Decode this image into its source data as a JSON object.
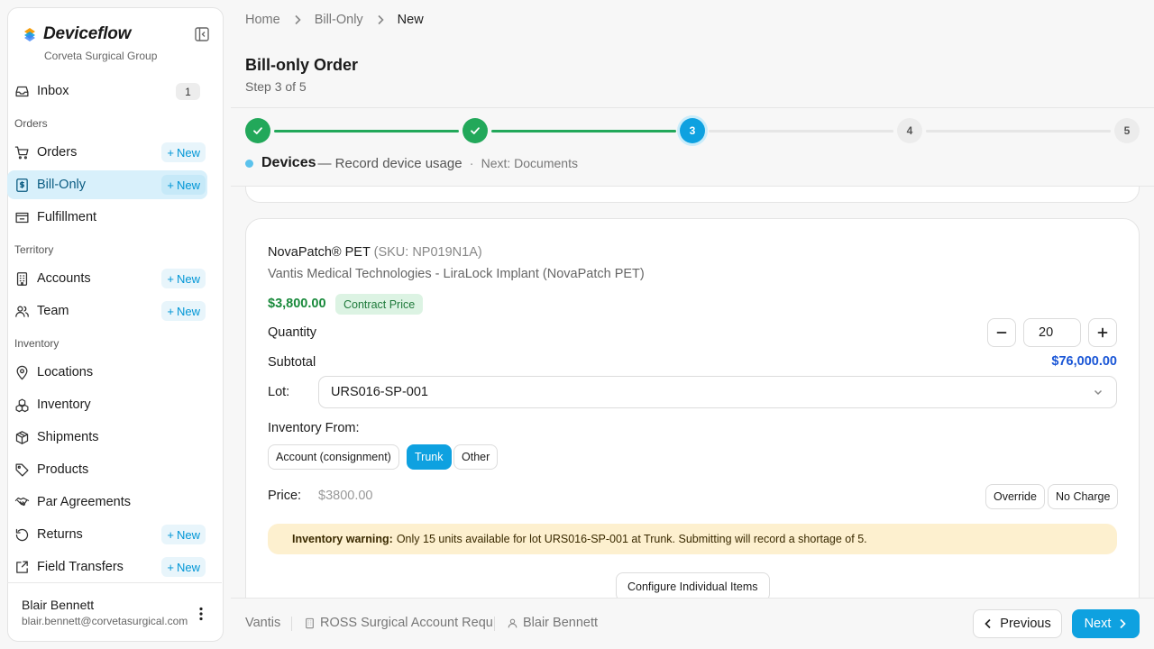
{
  "app": {
    "name": "Deviceflow",
    "org": "Corveta Surgical Group"
  },
  "sidebar": {
    "inbox": {
      "label": "Inbox",
      "count": "1"
    },
    "sections": {
      "orders": "Orders",
      "territory": "Territory",
      "inventory": "Inventory"
    },
    "items": [
      {
        "label": "Orders",
        "new": "New",
        "icon": "cart-icon"
      },
      {
        "label": "Bill-Only",
        "new": "New",
        "icon": "receipt-icon",
        "active": true
      },
      {
        "label": "Fulfillment",
        "icon": "fulfillment-icon"
      },
      {
        "label": "Accounts",
        "new": "New",
        "icon": "building-icon"
      },
      {
        "label": "Team",
        "new": "New",
        "icon": "users-icon"
      },
      {
        "label": "Locations",
        "icon": "map-pin-icon"
      },
      {
        "label": "Inventory",
        "icon": "boxes-icon"
      },
      {
        "label": "Shipments",
        "icon": "package-icon"
      },
      {
        "label": "Products",
        "icon": "tag-icon"
      },
      {
        "label": "Par Agreements",
        "icon": "handshake-icon"
      },
      {
        "label": "Returns",
        "new": "New",
        "icon": "undo-icon"
      },
      {
        "label": "Field Transfers",
        "new": "New",
        "icon": "transfer-icon"
      }
    ],
    "user": {
      "name": "Blair Bennett",
      "email": "blair.bennett@corvetasurgical.com"
    }
  },
  "breadcrumb": [
    "Home",
    "Bill-Only",
    "New"
  ],
  "page": {
    "title": "Bill-only Order",
    "subtitle": "Step 3 of 5"
  },
  "stepper": {
    "steps": [
      "1",
      "2",
      "3",
      "4",
      "5"
    ],
    "current_name": "Devices",
    "current_desc": "— Record device usage",
    "separator": "·",
    "next": "Next: Documents"
  },
  "product": {
    "name": "NovaPatch® PET",
    "sku": "(SKU: NP019N1A)",
    "description": "Vantis Medical Technologies - LiraLock Implant (NovaPatch PET)",
    "price": "$3,800.00",
    "price_badge": "Contract Price",
    "quantity_label": "Quantity",
    "quantity": "20",
    "subtotal_label": "Subtotal",
    "subtotal": "$76,000.00",
    "lot_label": "Lot:",
    "lot": "URS016-SP-001",
    "inventory_from_label": "Inventory From:",
    "inventory_from_options": [
      "Account (consignment)",
      "Trunk",
      "Other"
    ],
    "inventory_from_selected": "Trunk",
    "price_label": "Price:",
    "price_value": "$3800.00",
    "override_label": "Override",
    "no_charge_label": "No Charge",
    "warning_title": "Inventory warning:",
    "warning_text": "Only 15 units available for lot URS016-SP-001 at Trunk. Submitting will record a shortage of 5.",
    "configure_label": "Configure Individual Items"
  },
  "footer": {
    "vendor": "Vantis",
    "account": "ROSS Surgical Account Requ",
    "rep": "Blair Bennett",
    "prev_label": "Previous",
    "next_label": "Next"
  },
  "colors": {
    "accent": "#0ea1e0",
    "success": "#22a85a",
    "active_nav_bg": "#d8f0fb",
    "warning_bg": "#fdf0cf",
    "subtotal": "#1a56d6"
  }
}
